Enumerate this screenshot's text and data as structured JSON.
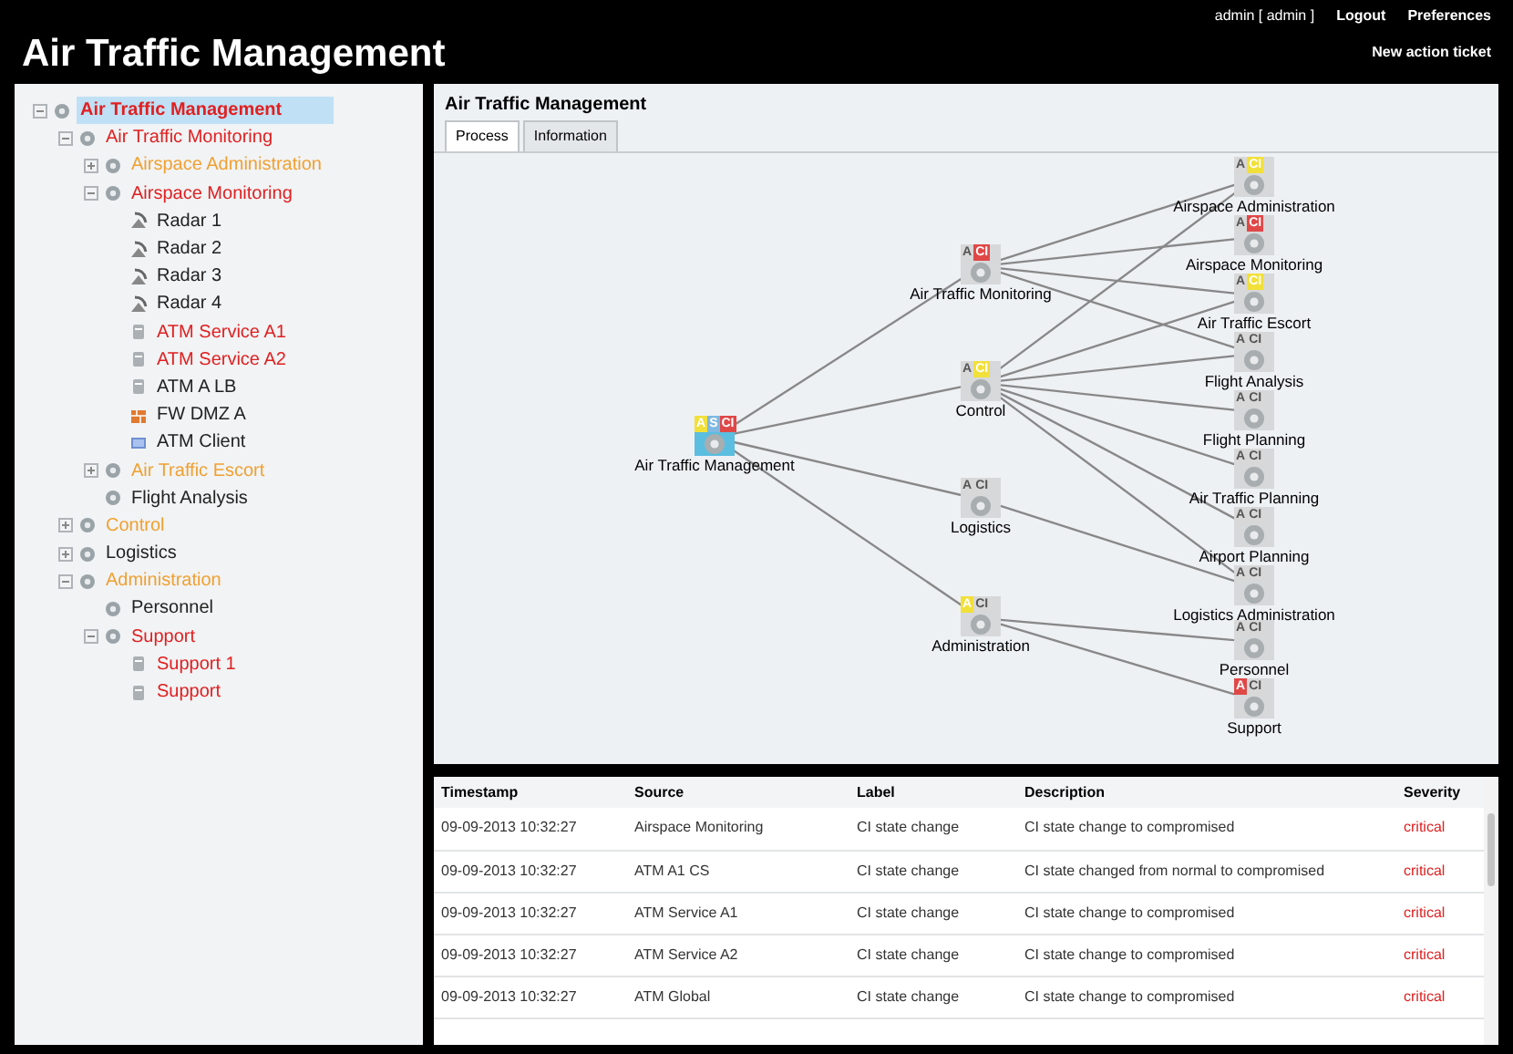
{
  "header": {
    "title": "Air Traffic Management",
    "user_link": "admin [ admin ]",
    "links": [
      "Logout",
      "Preferences"
    ],
    "action_link": "New action ticket"
  },
  "tree": [
    {
      "label": "Air Traffic Management",
      "kind": "process",
      "color": "#e02020",
      "expanded": true,
      "selected": true,
      "children": [
        {
          "label": "Air Traffic Monitoring",
          "kind": "process",
          "color": "#e02020",
          "expanded": true,
          "selected": false,
          "children": [
            {
              "label": "Airspace Administration",
              "kind": "process",
              "color": "#f0a030",
              "expanded": false,
              "selected": false
            },
            {
              "label": "Airspace Monitoring",
              "kind": "process",
              "color": "#e02020",
              "expanded": true,
              "selected": false,
              "children": [
                {
                  "label": "Radar 1",
                  "kind": "radar",
                  "color": "#222222",
                  "selected": false
                },
                {
                  "label": "Radar 2",
                  "kind": "radar",
                  "color": "#222222",
                  "selected": false
                },
                {
                  "label": "Radar 3",
                  "kind": "radar",
                  "color": "#222222",
                  "selected": false
                },
                {
                  "label": "Radar 4",
                  "kind": "radar",
                  "color": "#222222",
                  "selected": false
                },
                {
                  "label": "ATM Service A1",
                  "kind": "server",
                  "color": "#e02020",
                  "selected": false
                },
                {
                  "label": "ATM Service A2",
                  "kind": "server",
                  "color": "#e02020",
                  "selected": false
                },
                {
                  "label": "ATM A LB",
                  "kind": "server",
                  "color": "#222222",
                  "selected": false
                },
                {
                  "label": "FW DMZ A",
                  "kind": "firewall",
                  "color": "#222222",
                  "selected": false
                },
                {
                  "label": "ATM Client",
                  "kind": "client",
                  "color": "#222222",
                  "selected": false
                }
              ]
            },
            {
              "label": "Air Traffic Escort",
              "kind": "process",
              "color": "#f0a030",
              "expanded": false,
              "selected": false
            },
            {
              "label": "Flight Analysis",
              "kind": "process",
              "color": "#222222",
              "selected": false
            }
          ]
        },
        {
          "label": "Control",
          "kind": "process",
          "color": "#f0a030",
          "expanded": false,
          "selected": false
        },
        {
          "label": "Logistics",
          "kind": "process",
          "color": "#222222",
          "expanded": false,
          "selected": false
        },
        {
          "label": "Administration",
          "kind": "process",
          "color": "#f0a030",
          "expanded": true,
          "selected": false,
          "children": [
            {
              "label": "Personnel",
              "kind": "process",
              "color": "#222222",
              "selected": false
            },
            {
              "label": "Support",
              "kind": "process",
              "color": "#e02020",
              "expanded": true,
              "selected": false,
              "children": [
                {
                  "label": "Support 1",
                  "kind": "server",
                  "color": "#e02020",
                  "selected": false
                },
                {
                  "label": "Support",
                  "kind": "server",
                  "color": "#e02020",
                  "selected": false
                }
              ]
            }
          ]
        }
      ]
    }
  ],
  "panel": {
    "title": "Air Traffic Management",
    "tabs": [
      {
        "label": "Process",
        "selected": true
      },
      {
        "label": "Information",
        "selected": false
      }
    ]
  },
  "graph": {
    "nodes": [
      {
        "label": "Air Traffic Management",
        "root": true,
        "badges": [
          {
            "text": "A",
            "color": "#f2e03a"
          },
          {
            "text": "S",
            "color": "#7fb8e0"
          },
          {
            "text": "CI",
            "color": "#e04848"
          }
        ]
      },
      {
        "label": "Air Traffic Monitoring",
        "badges": [
          {
            "text": "A",
            "color": "#d8d8d8"
          },
          {
            "text": "CI",
            "color": "#e04848"
          }
        ]
      },
      {
        "label": "Control",
        "badges": [
          {
            "text": "A",
            "color": "#d8d8d8"
          },
          {
            "text": "CI",
            "color": "#f2e03a"
          }
        ]
      },
      {
        "label": "Logistics",
        "badges": [
          {
            "text": "A",
            "color": "#d8d8d8"
          },
          {
            "text": "CI",
            "color": "#d8d8d8"
          }
        ]
      },
      {
        "label": "Administration",
        "badges": [
          {
            "text": "A",
            "color": "#f2e03a"
          },
          {
            "text": "CI",
            "color": "#d8d8d8"
          }
        ]
      },
      {
        "label": "Airspace Administration",
        "badges": [
          {
            "text": "A",
            "color": "#d8d8d8"
          },
          {
            "text": "CI",
            "color": "#f2e03a"
          }
        ]
      },
      {
        "label": "Airspace Monitoring",
        "badges": [
          {
            "text": "A",
            "color": "#d8d8d8"
          },
          {
            "text": "CI",
            "color": "#e04848"
          }
        ]
      },
      {
        "label": "Air Traffic Escort",
        "badges": [
          {
            "text": "A",
            "color": "#d8d8d8"
          },
          {
            "text": "CI",
            "color": "#f2e03a"
          }
        ]
      },
      {
        "label": "Flight Analysis",
        "badges": [
          {
            "text": "A",
            "color": "#d8d8d8"
          },
          {
            "text": "CI",
            "color": "#d8d8d8"
          }
        ]
      },
      {
        "label": "Flight Planning",
        "badges": [
          {
            "text": "A",
            "color": "#d8d8d8"
          },
          {
            "text": "CI",
            "color": "#d8d8d8"
          }
        ]
      },
      {
        "label": "Air Traffic Planning",
        "badges": [
          {
            "text": "A",
            "color": "#d8d8d8"
          },
          {
            "text": "CI",
            "color": "#d8d8d8"
          }
        ]
      },
      {
        "label": "Airport Planning",
        "badges": [
          {
            "text": "A",
            "color": "#d8d8d8"
          },
          {
            "text": "CI",
            "color": "#d8d8d8"
          }
        ]
      },
      {
        "label": "Logistics Administration",
        "badges": [
          {
            "text": "A",
            "color": "#d8d8d8"
          },
          {
            "text": "CI",
            "color": "#d8d8d8"
          }
        ]
      },
      {
        "label": "Personnel",
        "badges": [
          {
            "text": "A",
            "color": "#d8d8d8"
          },
          {
            "text": "CI",
            "color": "#d8d8d8"
          }
        ]
      },
      {
        "label": "Support",
        "badges": [
          {
            "text": "A",
            "color": "#e04848"
          },
          {
            "text": "CI",
            "color": "#d8d8d8"
          }
        ]
      }
    ]
  },
  "events": {
    "columns": [
      "Timestamp",
      "Source",
      "Label",
      "Description",
      "Severity"
    ],
    "rows": [
      [
        "09-09-2013 10:32:27",
        "Airspace Monitoring",
        "CI state change",
        "CI state change to compromised",
        "critical"
      ],
      [
        "09-09-2013 10:32:27",
        "ATM A1 CS",
        "CI state change",
        "CI state changed from normal to compromised",
        "critical"
      ],
      [
        "09-09-2013 10:32:27",
        "ATM Service A1",
        "CI state change",
        "CI state change to compromised",
        "critical"
      ],
      [
        "09-09-2013 10:32:27",
        "ATM Service A2",
        "CI state change",
        "CI state change to compromised",
        "critical"
      ],
      [
        "09-09-2013 10:32:27",
        "ATM Global",
        "CI state change",
        "CI state change to compromised",
        "critical"
      ]
    ]
  }
}
